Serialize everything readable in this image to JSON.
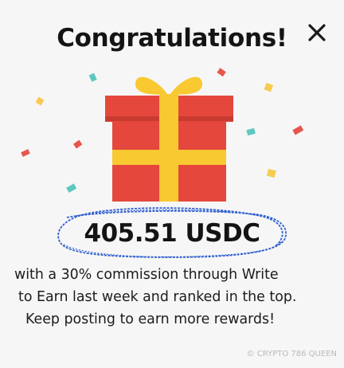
{
  "popup": {
    "title": "Congratulations!",
    "amount": "405.51 USDC",
    "description_lines": [
      "with a 30% commission through Write",
      "to Earn last week and ranked in the top.",
      "Keep posting to earn more rewards!"
    ],
    "close_icon": "close-icon",
    "gift_icon": "gift-box-icon"
  },
  "watermark": {
    "text": "CRYPTO 786 QUEEN",
    "icon": "copyright-icon"
  },
  "colors": {
    "gift_red": "#e5473c",
    "ribbon_yellow": "#f8c931",
    "scribble_blue": "#2f5fd0"
  }
}
